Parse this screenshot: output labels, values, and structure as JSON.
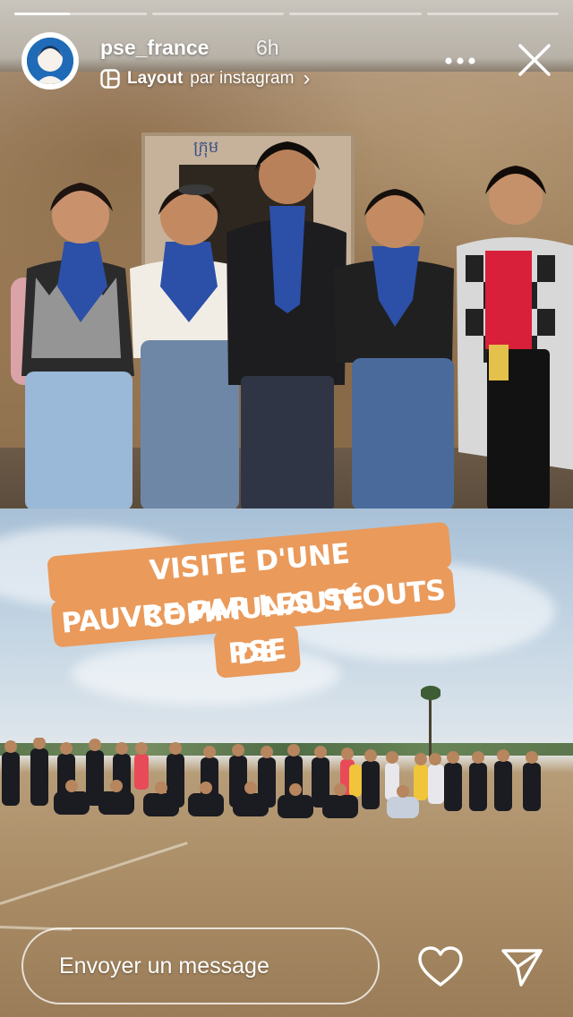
{
  "story": {
    "progress": [
      {
        "segment": 1,
        "complete": 0.42
      },
      {
        "segment": 2,
        "complete": 0
      },
      {
        "segment": 3,
        "complete": 0
      },
      {
        "segment": 4,
        "complete": 0
      }
    ]
  },
  "header": {
    "username": "pse_france",
    "time_ago": "6h",
    "attribution_app": "Layout",
    "attribution_suffix": "par instagram",
    "chevron": "›"
  },
  "photo_top": {
    "sign_text": "ក្រុម"
  },
  "caption": {
    "lines": [
      "VISITE D'UNE COMMUNAUTÉ",
      "PAUVRE PAR LES SCOUTS DE",
      "PSE"
    ],
    "background_color": "#ea9a5b",
    "text_color": "#ffffff"
  },
  "footer": {
    "message_placeholder": "Envoyer un message"
  },
  "icons": {
    "avatar": "profile-avatar",
    "layout": "layout-grid-icon",
    "more": "more-horizontal-icon",
    "close": "close-icon",
    "heart": "heart-icon",
    "send": "send-icon"
  }
}
